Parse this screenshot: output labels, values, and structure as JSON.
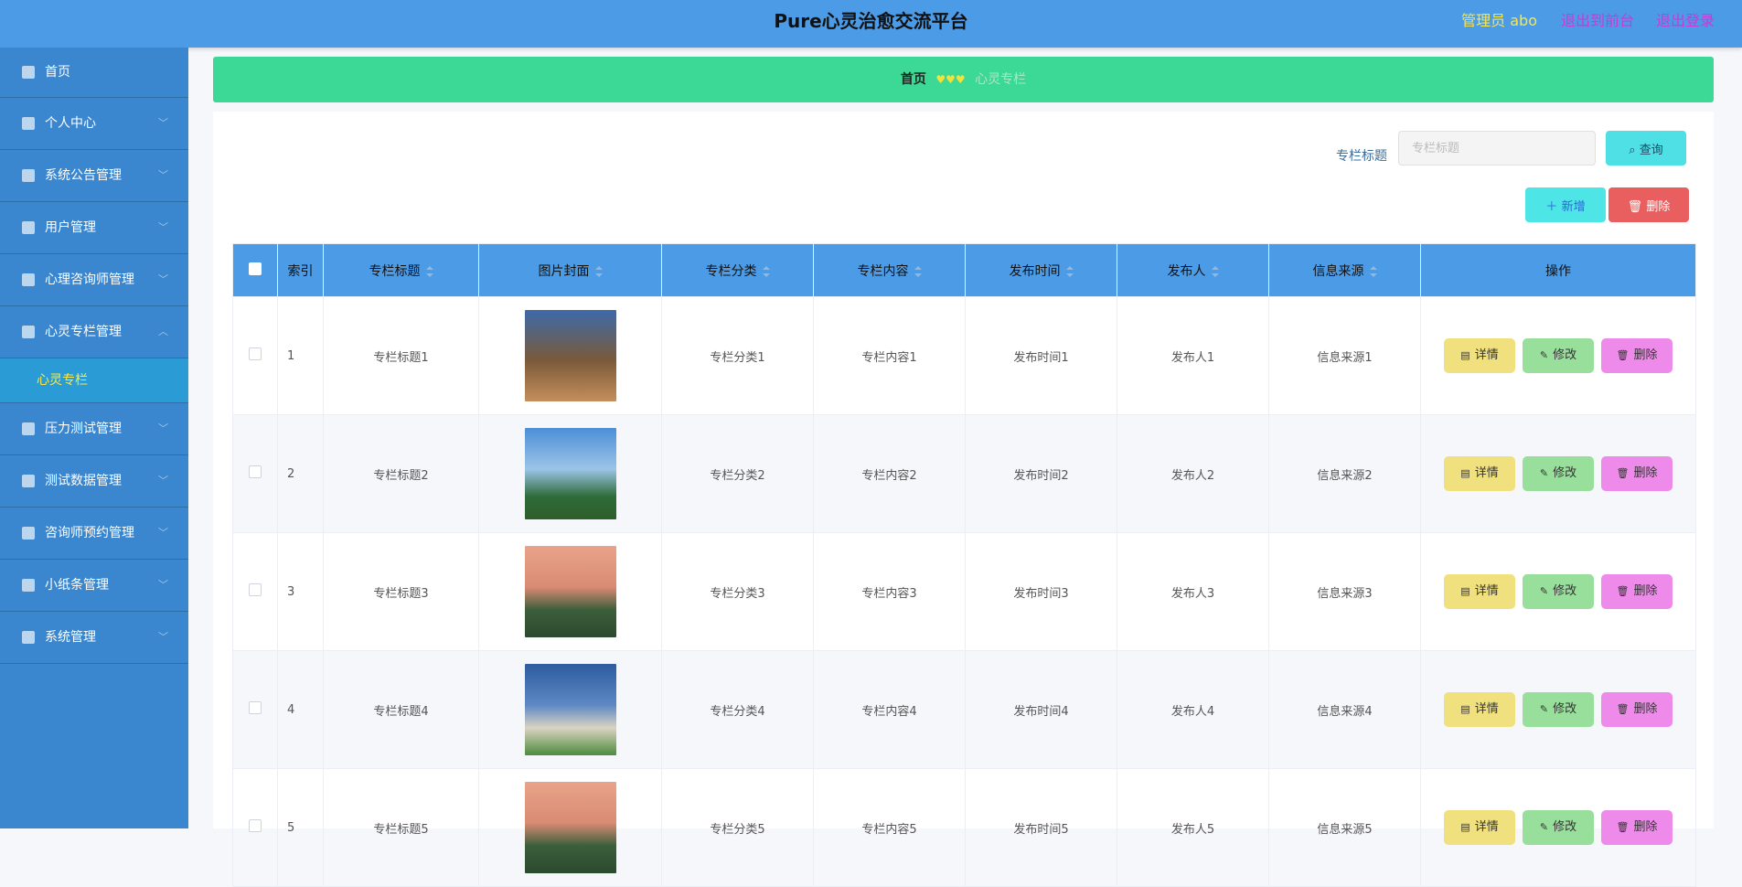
{
  "header": {
    "title": "Pure心灵治愈交流平台",
    "admin": "管理员 abo",
    "to_front": "退出到前台",
    "logout": "退出登录"
  },
  "sidebar": {
    "items": [
      {
        "label": "首页"
      },
      {
        "label": "个人中心"
      },
      {
        "label": "系统公告管理"
      },
      {
        "label": "用户管理"
      },
      {
        "label": "心理咨询师管理"
      },
      {
        "label": "心灵专栏管理"
      },
      {
        "label": "压力测试管理"
      },
      {
        "label": "测试数据管理"
      },
      {
        "label": "咨询师预约管理"
      },
      {
        "label": "小纸条管理"
      },
      {
        "label": "系统管理"
      }
    ],
    "sub_item": "心灵专栏"
  },
  "breadcrumb": {
    "home": "首页",
    "hearts": "♥♥♥",
    "current": "心灵专栏"
  },
  "search": {
    "label": "专栏标题",
    "placeholder": "专栏标题",
    "button": "查询"
  },
  "actions": {
    "add": "新增",
    "delete": "删除"
  },
  "table": {
    "columns": [
      "索引",
      "专栏标题",
      "图片封面",
      "专栏分类",
      "专栏内容",
      "发布时间",
      "发布人",
      "信息来源",
      "操作"
    ],
    "rows": [
      {
        "index": "1",
        "title": "专栏标题1",
        "category": "专栏分类1",
        "content": "专栏内容1",
        "time": "发布时间1",
        "publisher": "发布人1",
        "source": "信息来源1"
      },
      {
        "index": "2",
        "title": "专栏标题2",
        "category": "专栏分类2",
        "content": "专栏内容2",
        "time": "发布时间2",
        "publisher": "发布人2",
        "source": "信息来源2"
      },
      {
        "index": "3",
        "title": "专栏标题3",
        "category": "专栏分类3",
        "content": "专栏内容3",
        "time": "发布时间3",
        "publisher": "发布人3",
        "source": "信息来源3"
      },
      {
        "index": "4",
        "title": "专栏标题4",
        "category": "专栏分类4",
        "content": "专栏内容4",
        "time": "发布时间4",
        "publisher": "发布人4",
        "source": "信息来源4"
      },
      {
        "index": "5",
        "title": "专栏标题5",
        "category": "专栏分类5",
        "content": "专栏内容5",
        "time": "发布时间5",
        "publisher": "发布人5",
        "source": "信息来源5"
      }
    ],
    "row_actions": {
      "detail": "详情",
      "edit": "修改",
      "delete": "删除"
    }
  }
}
